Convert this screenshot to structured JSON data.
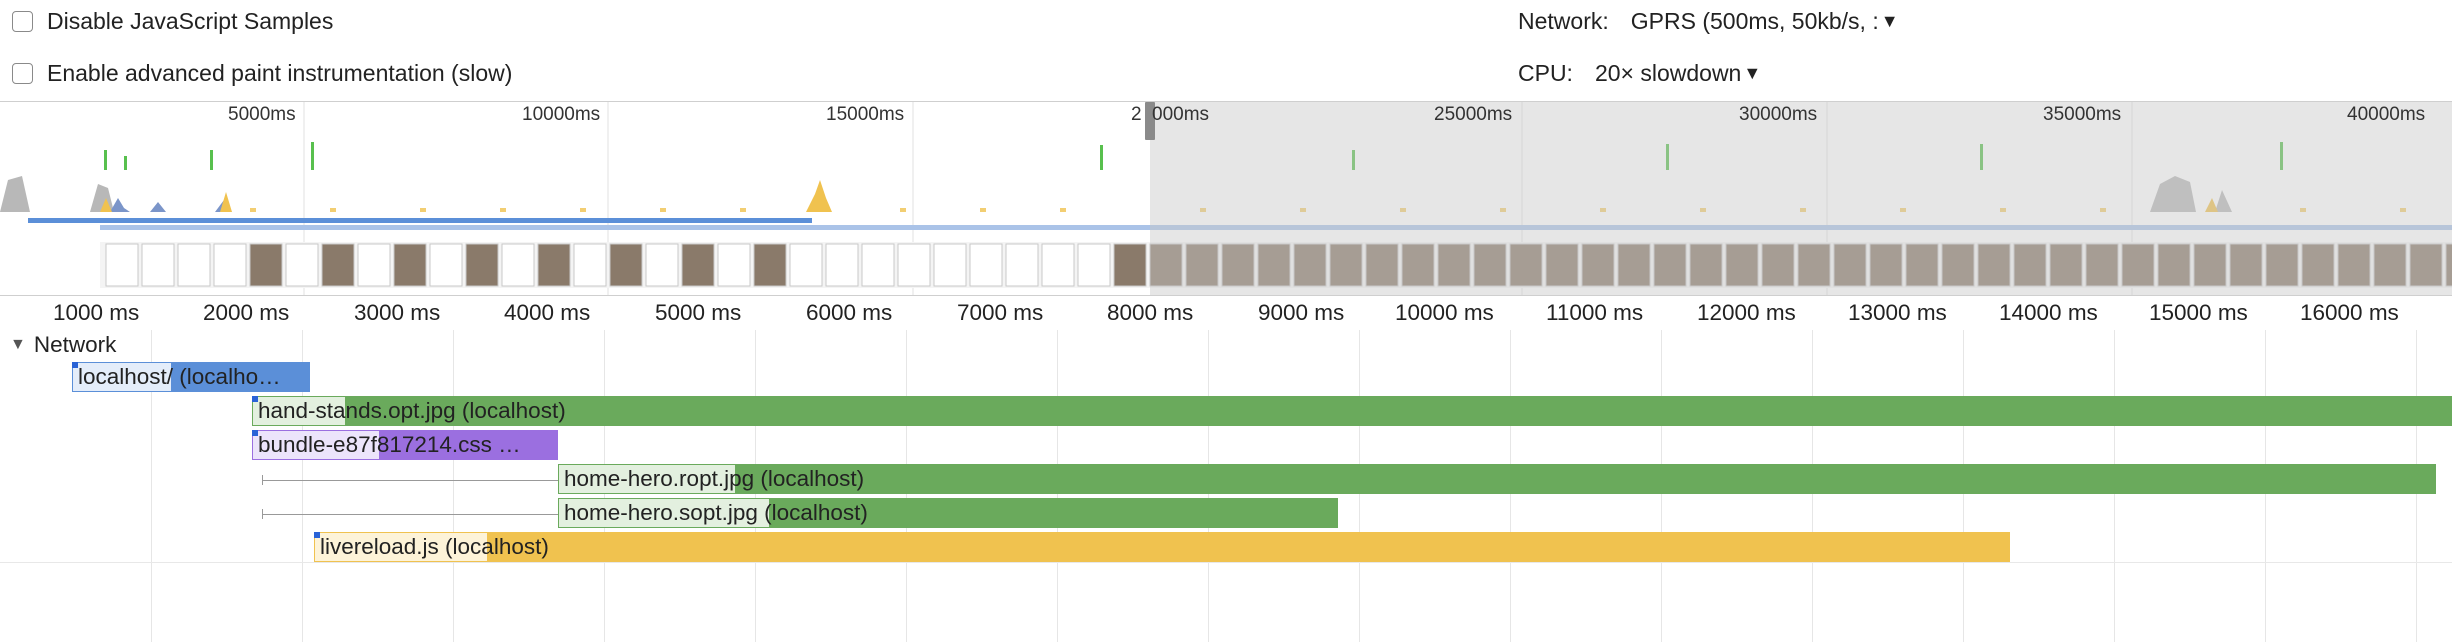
{
  "settings": {
    "disable_js_samples": {
      "label": "Disable JavaScript Samples",
      "checked": false
    },
    "advanced_paint": {
      "label": "Enable advanced paint instrumentation (slow)",
      "checked": false
    },
    "network": {
      "label": "Network:",
      "value": "GPRS (500ms, 50kb/s, :"
    },
    "cpu": {
      "label": "CPU:",
      "value": "20× slowdown"
    }
  },
  "overview": {
    "ticks": [
      "5000ms",
      "10000ms",
      "15000ms",
      "2",
      "000ms",
      "25000ms",
      "30000ms",
      "35000ms",
      "40000ms"
    ]
  },
  "ruler": {
    "ticks": [
      "1000 ms",
      "2000 ms",
      "3000 ms",
      "4000 ms",
      "5000 ms",
      "6000 ms",
      "7000 ms",
      "8000 ms",
      "9000 ms",
      "10000 ms",
      "11000 ms",
      "12000 ms",
      "13000 ms",
      "14000 ms",
      "15000 ms",
      "16000 ms"
    ]
  },
  "network": {
    "section_label": "Network",
    "requests": [
      {
        "label": "localhost/ (localho…",
        "type": "document",
        "color": "#5b8fd8"
      },
      {
        "label": "hand-stands.opt.jpg (localhost)",
        "type": "image",
        "color": "#6aaa5c"
      },
      {
        "label": "bundle-e87f817214.css …",
        "type": "stylesheet",
        "color": "#9b6fe0"
      },
      {
        "label": "home-hero.ropt.jpg (localhost)",
        "type": "image",
        "color": "#6aaa5c"
      },
      {
        "label": "home-hero.sopt.jpg (localhost)",
        "type": "image",
        "color": "#6aaa5c"
      },
      {
        "label": "livereload.js (localhost)",
        "type": "script",
        "color": "#f0c24f"
      }
    ]
  },
  "colors": {
    "document": "#5b8fd8",
    "image": "#6aaa5c",
    "stylesheet": "#9b6fe0",
    "script": "#f0c24f",
    "selection_shade": "#c8c8c8"
  }
}
